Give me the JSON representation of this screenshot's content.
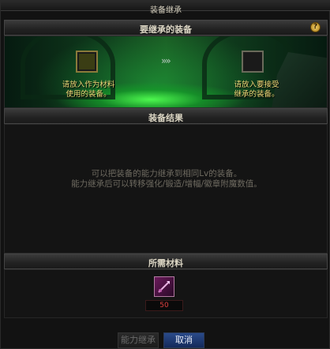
{
  "window": {
    "title": "装备继承"
  },
  "inherit_section": {
    "header": "要继承的装备",
    "help_label": "?",
    "source_slot_hint_line1": "请放入作为材料",
    "source_slot_hint_line2": "使用的装备。",
    "target_slot_hint_line1": "请放入要接受",
    "target_slot_hint_line2": "继承的装备。",
    "arrows": "»»"
  },
  "result_section": {
    "header": "装备结果",
    "description_line1": "可以把装备的能力继承到相同Lv的装备。",
    "description_line2": "能力继承后可以转移强化/锻造/增幅/徽章附魔数值。"
  },
  "material_section": {
    "header": "所需材料",
    "quantity": "50",
    "item_icon": "purple-stone-icon"
  },
  "buttons": {
    "inherit": "能力继承",
    "cancel": "取消"
  },
  "colors": {
    "accent_green": "#2fd44a",
    "hint_yellow": "#f0d878",
    "quantity_red": "#e04040",
    "cancel_blue": "#2a4a8a"
  }
}
